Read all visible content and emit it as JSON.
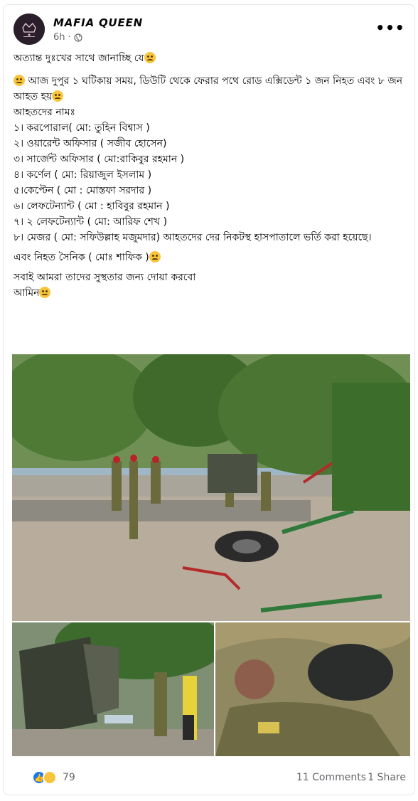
{
  "post": {
    "page_name": "MAFIA QUEEN",
    "time": "6h",
    "privacy_icon": "globe-icon",
    "more_label": "•••",
    "lines": [
      "অত্যান্ত দুঃখের সাথে জানাচ্ছি যে",
      "",
      " আজ দুপুর ১ ঘটিকায় সময়, ডিউটি থেকে ফেরার পথে রোড এক্সিডেন্ট ১ জন  নিহত এবং ৮ জন আহত হয়",
      "আহতদের নামঃ",
      "১। করপোরাল( মো: তুহিন বিশ্বাস )",
      "২। ওয়ারেন্ট অফিসার ( সজীব হোসেন)",
      "৩। সার্জেন্ট অফিসার ( মো:রাকিবুর রহমান )",
      "৪। কর্ণেল ( মো: রিয়াজুল ইসলাম )",
      "৫।কেপ্টেন ( মো : মোস্তফা সরদার )",
      "৬। লেফটেন্যান্ট ( মো : হাবিবুর রহমান )",
      "৭। ২ লেফটেন্যান্ট ( মো: আরিফ শেখ )",
      "৮। মেজর ( মো: সফিউল্লাহ মজুমদার) আহতদের  দের নিকটস্থ হাসপাতালে ভর্তি করা হয়েছে।",
      "এবং নিহত সৈনিক ( মোঃ শাফিক )",
      "সবাই আমরা তাদের সুস্থতার জন্য দোয়া করবো",
      "আমিন"
    ]
  },
  "footer": {
    "reaction_count": "79",
    "comments": "11 Comments",
    "shares": "1 Share"
  },
  "colors": {
    "accent": "#1877f2",
    "secondary_text": "#65676b"
  }
}
